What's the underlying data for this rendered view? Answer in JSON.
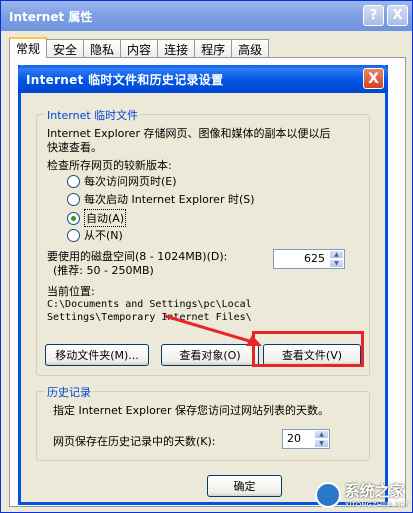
{
  "back_window": {
    "title": "Internet 属性",
    "help_btn": "?",
    "close_btn": "X",
    "tabs": [
      "常规",
      "安全",
      "隐私",
      "内容",
      "连接",
      "程序",
      "高级"
    ]
  },
  "dialog": {
    "title": "Internet 临时文件和历史记录设置",
    "close_btn": "X",
    "temp_group": {
      "title": "Internet 临时文件",
      "desc_line1": "Internet Explorer 存储网页、图像和媒体的副本以便以后",
      "desc_line2": "快速查看。",
      "check_label": "检查所存网页的较新版本:",
      "options": [
        {
          "label": "每次访问网页时(E)",
          "selected": false
        },
        {
          "label": "每次启动 Internet Explorer 时(S)",
          "selected": false
        },
        {
          "label": "自动(A)",
          "selected": true
        },
        {
          "label": "从不(N)",
          "selected": false
        }
      ],
      "disk_label": "要使用的磁盘空间(8 - 1024MB)(D):",
      "disk_hint": "(推荐: 50 - 250MB)",
      "disk_value": "625",
      "location_label": "当前位置:",
      "location_line1": "C:\\Documents and Settings\\pc\\Local",
      "location_line2": "Settings\\Temporary Internet Files\\",
      "btn_move": "移动文件夹(M)...",
      "btn_view_objects": "查看对象(O)",
      "btn_view_files": "查看文件(V)"
    },
    "history_group": {
      "title": "历史记录",
      "desc": "指定 Internet Explorer 保存您访问过网站列表的天数。",
      "days_label": "网页保存在历史记录中的天数(K):",
      "days_value": "20"
    },
    "ok_btn": "确定"
  },
  "colors": {
    "highlight": "#E8262A",
    "titlebar_blue": "#0055E5"
  },
  "watermark": {
    "text": "系统之家",
    "sub": "XITONGZHIJIA.NET"
  }
}
